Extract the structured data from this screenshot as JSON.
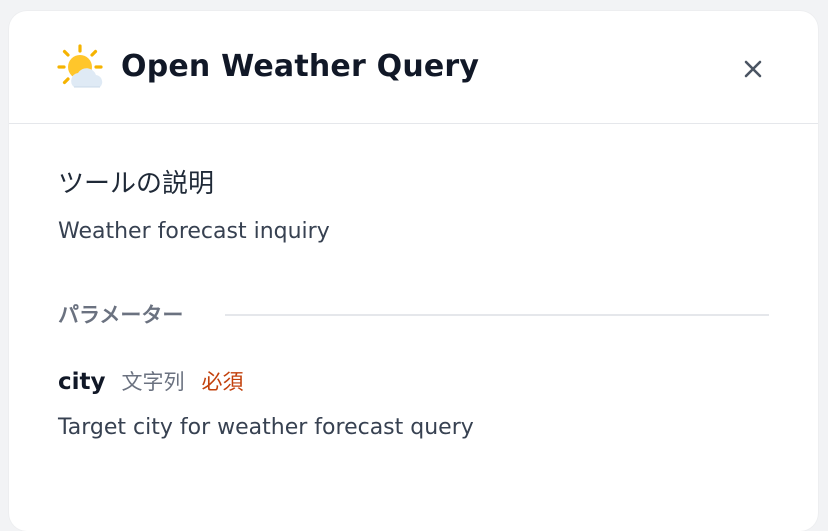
{
  "dialog": {
    "title": "Open Weather Query",
    "icon": "sun-behind-cloud-icon",
    "close_icon": "close-icon"
  },
  "tool": {
    "description_heading": "ツールの説明",
    "description": "Weather forecast inquiry"
  },
  "parameters": {
    "heading": "パラメーター",
    "items": [
      {
        "name": "city",
        "type": "文字列",
        "required_label": "必須",
        "description": "Target city for weather forecast query"
      }
    ]
  },
  "colors": {
    "required": "#c2410c",
    "muted": "#6b7280",
    "title": "#111827"
  }
}
